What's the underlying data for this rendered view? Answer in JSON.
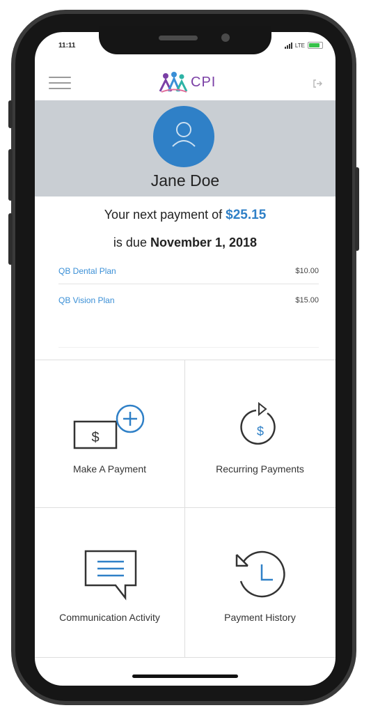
{
  "status": {
    "time": "11:11",
    "network": "LTE"
  },
  "app": {
    "logo_text": "CPI"
  },
  "profile": {
    "name": "Jane Doe"
  },
  "payment": {
    "line1_prefix": "Your next payment of ",
    "amount": "$25.15",
    "line2_prefix": "is due ",
    "due_date": "November 1, 2018"
  },
  "plans": [
    {
      "name": "QB Dental Plan",
      "amount": "$10.00"
    },
    {
      "name": "QB Vision Plan",
      "amount": "$15.00"
    }
  ],
  "tiles": {
    "make_payment": "Make A Payment",
    "recurring": "Recurring Payments",
    "communication": "Communication Activity",
    "history": "Payment History"
  },
  "colors": {
    "accent": "#2f80c7",
    "profile_bg": "#c9ced3",
    "logo": "#7a3fa5"
  },
  "icons": {
    "menu": "hamburger-icon",
    "logout": "logout-icon",
    "avatar": "user-icon",
    "make_payment": "card-dollar-plus-icon",
    "recurring": "dollar-cycle-icon",
    "communication": "chat-bubble-icon",
    "history": "clock-history-icon"
  }
}
